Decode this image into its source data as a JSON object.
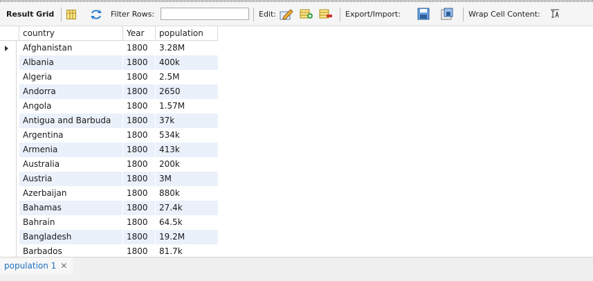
{
  "toolbar": {
    "result_grid_label": "Result Grid",
    "filter_label": "Filter Rows:",
    "filter_value": "",
    "edit_label": "Edit:",
    "export_label": "Export/Import:",
    "wrap_label": "Wrap Cell Content:"
  },
  "grid": {
    "columns": [
      "country",
      "Year",
      "population"
    ],
    "rows": [
      [
        "Afghanistan",
        "1800",
        "3.28M"
      ],
      [
        "Albania",
        "1800",
        "400k"
      ],
      [
        "Algeria",
        "1800",
        "2.5M"
      ],
      [
        "Andorra",
        "1800",
        "2650"
      ],
      [
        "Angola",
        "1800",
        "1.57M"
      ],
      [
        "Antigua and Barbuda",
        "1800",
        "37k"
      ],
      [
        "Argentina",
        "1800",
        "534k"
      ],
      [
        "Armenia",
        "1800",
        "413k"
      ],
      [
        "Australia",
        "1800",
        "200k"
      ],
      [
        "Austria",
        "1800",
        "3M"
      ],
      [
        "Azerbaijan",
        "1800",
        "880k"
      ],
      [
        "Bahamas",
        "1800",
        "27.4k"
      ],
      [
        "Bahrain",
        "1800",
        "64.5k"
      ],
      [
        "Bangladesh",
        "1800",
        "19.2M"
      ],
      [
        "Barbados",
        "1800",
        "81.7k"
      ]
    ],
    "selected_row": 0
  },
  "tabs": [
    {
      "label": "population 1",
      "active": true
    }
  ],
  "colors": {
    "alt_row": "#eaf1fb",
    "tab_text": "#1f6fbf"
  }
}
